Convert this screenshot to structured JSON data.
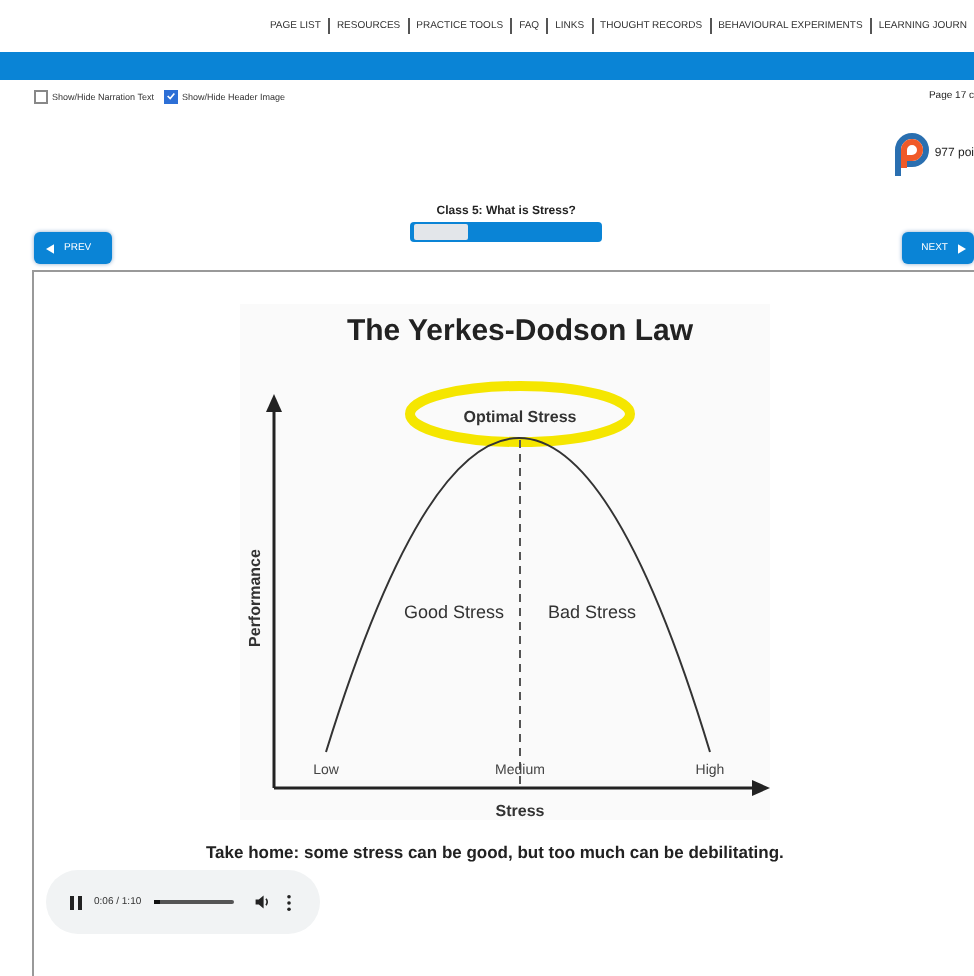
{
  "nav": {
    "items": [
      "PAGE LIST",
      "RESOURCES",
      "PRACTICE TOOLS",
      "FAQ",
      "LINKS",
      "THOUGHT RECORDS",
      "BEHAVIOURAL EXPERIMENTS",
      "LEARNING JOURN"
    ]
  },
  "options": [
    {
      "label": "Show/Hide Narration Text",
      "checked": false
    },
    {
      "label": "Show/Hide Header Image",
      "checked": true
    }
  ],
  "page_counter": "Page 17 c",
  "points": "977 poi",
  "lesson": {
    "title": "Class 5: What is Stress?",
    "level": 0.29
  },
  "prev_button": "PREV",
  "next_button": "NEXT",
  "figure": {
    "title": "The Yerkes-Dodson Law",
    "peak_label": "Optimal Stress",
    "left_label": "Good Stress",
    "right_label": "Bad Stress",
    "y_axis": "Performance",
    "x_axis": "Stress",
    "x_labels": [
      "Low",
      "Medium",
      "High"
    ]
  },
  "caption": "Take home: some stress can be good, but too much can be debilitating.",
  "audio": {
    "playing": true,
    "time": "0:06 / 1:10",
    "level": 0.09
  }
}
